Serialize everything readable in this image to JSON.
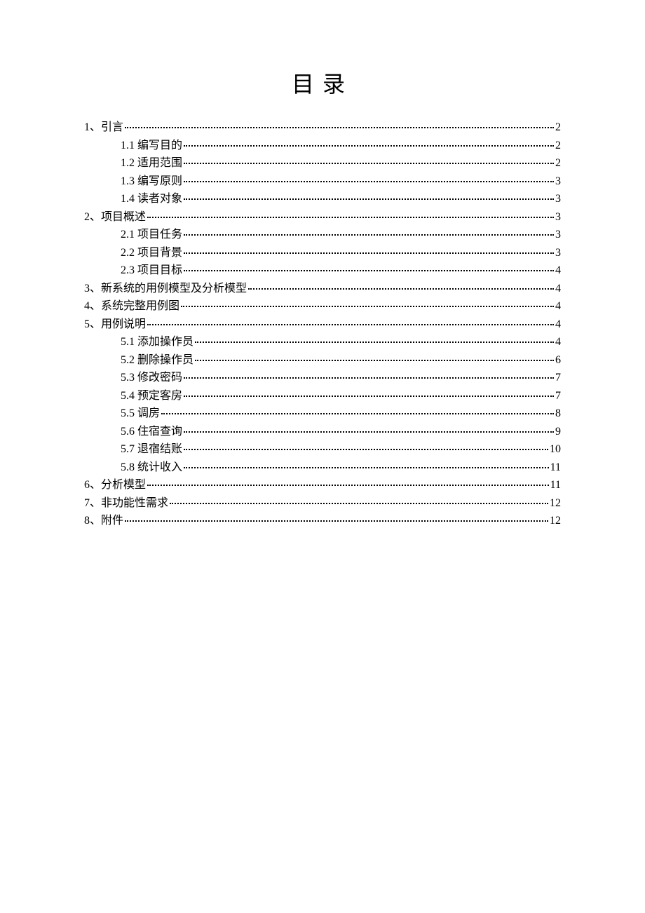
{
  "title": "目录",
  "toc": [
    {
      "level": 1,
      "prefix": "1、",
      "label": "引言",
      "page": "2"
    },
    {
      "level": 2,
      "prefix": "",
      "label": "1.1 编写目的",
      "page": "2"
    },
    {
      "level": 2,
      "prefix": "",
      "label": "1.2 适用范围",
      "page": "2"
    },
    {
      "level": 2,
      "prefix": "",
      "label": "1.3 编写原则",
      "page": "3"
    },
    {
      "level": 2,
      "prefix": "",
      "label": "1.4 读者对象",
      "page": "3"
    },
    {
      "level": 1,
      "prefix": "2、",
      "label": "项目概述",
      "page": "3"
    },
    {
      "level": 2,
      "prefix": "",
      "label": "2.1 项目任务",
      "page": "3"
    },
    {
      "level": 2,
      "prefix": "",
      "label": "2.2 项目背景",
      "page": "3"
    },
    {
      "level": 2,
      "prefix": "",
      "label": "2.3 项目目标",
      "page": "4"
    },
    {
      "level": 1,
      "prefix": "3、",
      "label": "新系统的用例模型及分析模型",
      "page": "4"
    },
    {
      "level": 1,
      "prefix": "4、",
      "label": "系统完整用例图",
      "page": "4"
    },
    {
      "level": 1,
      "prefix": "5、",
      "label": "用例说明",
      "page": "4"
    },
    {
      "level": 2,
      "prefix": "",
      "label": "5.1 添加操作员",
      "page": "4"
    },
    {
      "level": 2,
      "prefix": "",
      "label": "5.2 删除操作员",
      "page": "6"
    },
    {
      "level": 2,
      "prefix": "",
      "label": "5.3 修改密码",
      "page": "7"
    },
    {
      "level": 2,
      "prefix": "",
      "label": "5.4 预定客房",
      "page": "7"
    },
    {
      "level": 2,
      "prefix": "",
      "label": "5.5 调房",
      "page": "8"
    },
    {
      "level": 2,
      "prefix": "",
      "label": "5.6 住宿查询",
      "page": "9"
    },
    {
      "level": 2,
      "prefix": "",
      "label": "5.7 退宿结账",
      "page": "10"
    },
    {
      "level": 2,
      "prefix": "",
      "label": "5.8 统计收入",
      "page": "11"
    },
    {
      "level": 1,
      "prefix": "6、",
      "label": "分析模型",
      "page": "11"
    },
    {
      "level": 1,
      "prefix": "7、",
      "label": "非功能性需求",
      "page": "12"
    },
    {
      "level": 1,
      "prefix": "8、",
      "label": "附件",
      "page": "12"
    }
  ]
}
